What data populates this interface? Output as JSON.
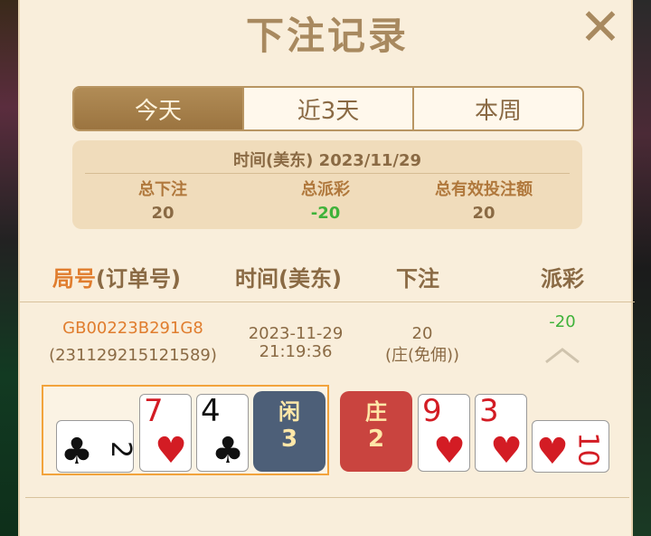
{
  "title": "下注记录",
  "tabs": [
    {
      "label": "今天",
      "active": true
    },
    {
      "label": "近3天",
      "active": false
    },
    {
      "label": "本周",
      "active": false
    }
  ],
  "summary": {
    "date": "时间(美东)  2023/11/29",
    "total_bet_label": "总下注",
    "total_bet": "20",
    "total_payout_label": "总派彩",
    "total_payout": "-20",
    "valid_bet_label": "总有效投注额",
    "valid_bet": "20"
  },
  "columns": {
    "round_prefix": "局号",
    "round_suffix": "(订单号)",
    "time": "时间(美东)",
    "bet": "下注",
    "payout": "派彩"
  },
  "record": {
    "game_id": "GB00223B291G8",
    "order_no": "(231129215121589)",
    "date": "2023-11-29",
    "time": "21:19:36",
    "bet_amount": "20",
    "bet_type": "(庄(免佣))",
    "payout": "-20"
  },
  "player": {
    "label": "闲",
    "points": "3",
    "cards": [
      {
        "rank": "2",
        "suit": "♣",
        "color": "black",
        "rotated": true
      },
      {
        "rank": "7",
        "suit": "♥",
        "color": "red",
        "rotated": false
      },
      {
        "rank": "4",
        "suit": "♣",
        "color": "black",
        "rotated": false
      }
    ]
  },
  "banker": {
    "label": "庄",
    "points": "2",
    "cards": [
      {
        "rank": "9",
        "suit": "♥",
        "color": "red",
        "rotated": false
      },
      {
        "rank": "3",
        "suit": "♥",
        "color": "red",
        "rotated": false
      },
      {
        "rank": "10",
        "suit": "♥",
        "color": "red",
        "rotated": true
      }
    ]
  },
  "colors": {
    "accent": "#a8895f",
    "orange": "#e07d2e",
    "green": "#3fb23a",
    "player_tag": "#4d5f78",
    "banker_tag": "#c9443f",
    "highlight_border": "#f2a33c"
  }
}
